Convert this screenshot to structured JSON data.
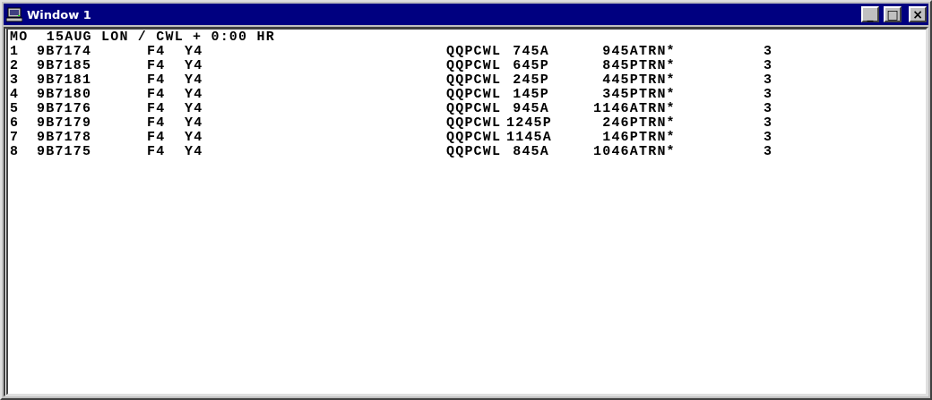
{
  "window": {
    "title": "Window 1",
    "controls": [
      "_",
      "□",
      "×"
    ]
  },
  "header": "MO  15AUG LON / CWL + 0:00 HR",
  "rows": [
    {
      "number": "1",
      "flight": "9B7174",
      "class_f": "F4",
      "class_y": "Y4",
      "segment": "QQPCWL",
      "depart": "745A",
      "arrive": "945A",
      "equipment": "TRN*",
      "stops": "3"
    },
    {
      "number": "2",
      "flight": "9B7185",
      "class_f": "F4",
      "class_y": "Y4",
      "segment": "QQPCWL",
      "depart": "645P",
      "arrive": "845P",
      "equipment": "TRN*",
      "stops": "3"
    },
    {
      "number": "3",
      "flight": "9B7181",
      "class_f": "F4",
      "class_y": "Y4",
      "segment": "QQPCWL",
      "depart": "245P",
      "arrive": "445P",
      "equipment": "TRN*",
      "stops": "3"
    },
    {
      "number": "4",
      "flight": "9B7180",
      "class_f": "F4",
      "class_y": "Y4",
      "segment": "QQPCWL",
      "depart": "145P",
      "arrive": "345P",
      "equipment": "TRN*",
      "stops": "3"
    },
    {
      "number": "5",
      "flight": "9B7176",
      "class_f": "F4",
      "class_y": "Y4",
      "segment": "QQPCWL",
      "depart": "945A",
      "arrive": "1146A",
      "equipment": "TRN*",
      "stops": "3"
    },
    {
      "number": "6",
      "flight": "9B7179",
      "class_f": "F4",
      "class_y": "Y4",
      "segment": "QQPCWL",
      "depart": "1245P",
      "arrive": "246P",
      "equipment": "TRN*",
      "stops": "3"
    },
    {
      "number": "7",
      "flight": "9B7178",
      "class_f": "F4",
      "class_y": "Y4",
      "segment": "QQPCWL",
      "depart": "1145A",
      "arrive": "146P",
      "equipment": "TRN*",
      "stops": "3"
    },
    {
      "number": "8",
      "flight": "9B7175",
      "class_f": "F4",
      "class_y": "Y4",
      "segment": "QQPCWL",
      "depart": "845A",
      "arrive": "1046A",
      "equipment": "TRN*",
      "stops": "3"
    }
  ]
}
